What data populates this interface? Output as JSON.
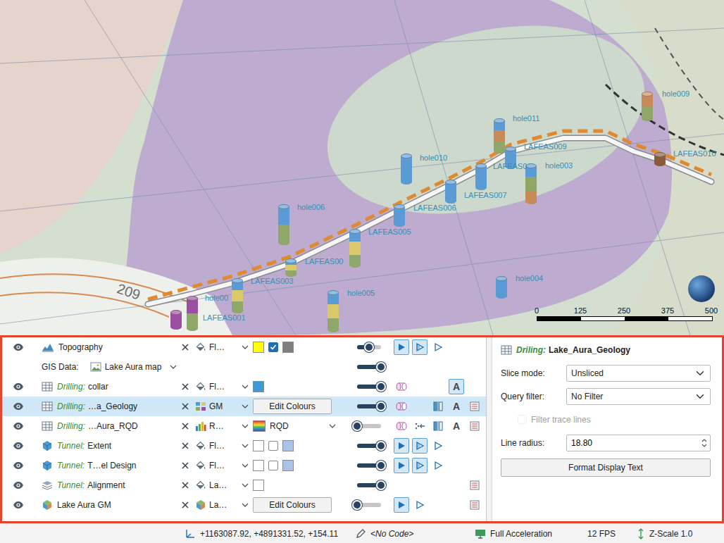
{
  "viewer": {
    "holes": [
      {
        "label": "hole009",
        "segments": [
          "#c98a5a",
          "#8fa86a"
        ]
      },
      {
        "label": "hole011",
        "segments": [
          "#5b9bd5",
          "#c98a5a",
          "#8fa86a"
        ]
      },
      {
        "label": "LAFEAS009",
        "segments": [
          "#5b9bd5"
        ]
      },
      {
        "label": "LAFEAS010",
        "segments": [
          "#8b5a3a"
        ]
      },
      {
        "label": "hole003",
        "segments": [
          "#5b9bd5",
          "#8fa86a",
          "#c98a5a"
        ]
      },
      {
        "label": "LAFEAS0",
        "segments": [
          "#5b9bd5"
        ]
      },
      {
        "label": "LAFEAS007",
        "segments": [
          "#5b9bd5"
        ]
      },
      {
        "label": "hole010",
        "segments": [
          "#5b9bd5"
        ]
      },
      {
        "label": "LAFEAS006",
        "segments": [
          "#5b9bd5"
        ]
      },
      {
        "label": "hole006",
        "segments": [
          "#5b9bd5",
          "#8fa86a"
        ]
      },
      {
        "label": "LAFEAS005",
        "segments": [
          "#5b9bd5",
          "#d9c96a",
          "#8fa86a"
        ]
      },
      {
        "label": "LAFEAS00",
        "segments": [
          "#5b9bd5",
          "#d9c96a",
          "#8fa86a"
        ]
      },
      {
        "label": "LAFEAS003",
        "segments": [
          "#5b9bd5",
          "#d9c96a",
          "#8fa86a"
        ]
      },
      {
        "label": "hole005",
        "segments": [
          "#5b9bd5",
          "#d9c96a",
          "#8fa86a"
        ]
      },
      {
        "label": "hole004",
        "segments": [
          "#5b9bd5"
        ]
      },
      {
        "label": "hole00",
        "segments": [
          "#9b4fa0",
          "#8fa86a"
        ]
      },
      {
        "label": "LAFEAS001",
        "segments": [
          "#9b4fa0"
        ]
      }
    ],
    "contour_label": "209",
    "scale": [
      "0",
      "125",
      "250",
      "375",
      "500"
    ]
  },
  "shape_list": {
    "rows": [
      {
        "kind": "topography",
        "name": "Topography",
        "visible": true,
        "selected": false,
        "style": {
          "kind": "fill",
          "text": "Fl…"
        },
        "colors": {
          "kind": "swatches",
          "items": [
            {
              "kind": "swatch",
              "color": "#ffff00"
            },
            {
              "kind": "checkbox",
              "checked": true
            },
            {
              "kind": "swatch",
              "color": "#7f7f7f"
            }
          ]
        },
        "slider": {
          "level": 0.5
        },
        "tools": [
          {
            "kind": "play",
            "pressed": true
          },
          {
            "kind": "slice",
            "pressed": true
          },
          {
            "kind": "triangle",
            "pressed": false
          },
          {
            "kind": "none"
          },
          {
            "kind": "none"
          }
        ]
      },
      {
        "kind": "gis",
        "name": "GIS Data:",
        "map": "Lake Aura map",
        "selected": false,
        "slider": {
          "level": 1
        },
        "tools": [
          {
            "kind": "none"
          },
          {
            "kind": "none"
          },
          {
            "kind": "none"
          },
          {
            "kind": "none"
          },
          {
            "kind": "none"
          }
        ]
      },
      {
        "kind": "drillhole",
        "prefix": "Drilling:",
        "name": "collar",
        "visible": true,
        "selected": false,
        "style": {
          "kind": "fill",
          "text": "Fl…"
        },
        "colors": {
          "kind": "swatches",
          "items": [
            {
              "kind": "swatch",
              "color": "#3d9ad8"
            }
          ]
        },
        "slider": {
          "level": 1
        },
        "tools": [
          {
            "kind": "cylinder",
            "pressed": false
          },
          {
            "kind": "none"
          },
          {
            "kind": "none"
          },
          {
            "kind": "label",
            "text": "A",
            "pressed": true
          },
          {
            "kind": "none"
          }
        ]
      },
      {
        "kind": "drillhole",
        "prefix": "Drilling:",
        "name": "…a_Geology",
        "visible": true,
        "selected": true,
        "style": {
          "kind": "category",
          "text": "GM"
        },
        "colors": {
          "kind": "button",
          "text": "Edit Colours"
        },
        "slider": {
          "level": 1
        },
        "tools": [
          {
            "kind": "cylinder",
            "pressed": false
          },
          {
            "kind": "none"
          },
          {
            "kind": "bars",
            "pressed": false
          },
          {
            "kind": "label",
            "text": "A",
            "pressed": false
          },
          {
            "kind": "table",
            "pressed": false
          }
        ]
      },
      {
        "kind": "drillhole",
        "prefix": "Drilling:",
        "name": "…Aura_RQD",
        "visible": true,
        "selected": false,
        "style": {
          "kind": "range",
          "text": "R…"
        },
        "colors": {
          "kind": "gradient",
          "text": "RQD"
        },
        "slider": {
          "level": 0
        },
        "tools": [
          {
            "kind": "cylinder",
            "pressed": false
          },
          {
            "kind": "arrows",
            "pressed": false
          },
          {
            "kind": "bars",
            "pressed": false
          },
          {
            "kind": "label",
            "text": "A",
            "pressed": false
          },
          {
            "kind": "table",
            "pressed": false
          }
        ]
      },
      {
        "kind": "mesh",
        "prefix": "Tunnel:",
        "name": "Extent",
        "visible": true,
        "selected": false,
        "style": {
          "kind": "fill",
          "text": "Fl…"
        },
        "colors": {
          "kind": "swatches",
          "items": [
            {
              "kind": "swatch",
              "color": "#ffffff"
            },
            {
              "kind": "checkbox",
              "checked": false
            },
            {
              "kind": "swatch",
              "color": "#a9c4e8"
            }
          ]
        },
        "slider": {
          "level": 1
        },
        "tools": [
          {
            "kind": "play",
            "pressed": true
          },
          {
            "kind": "slice",
            "pressed": true
          },
          {
            "kind": "triangle",
            "pressed": false
          },
          {
            "kind": "none"
          },
          {
            "kind": "none"
          }
        ]
      },
      {
        "kind": "mesh",
        "prefix": "Tunnel:",
        "name": "T…el Design",
        "visible": true,
        "selected": false,
        "style": {
          "kind": "fill",
          "text": "Fl…"
        },
        "colors": {
          "kind": "swatches",
          "items": [
            {
              "kind": "swatch",
              "color": "#ffffff"
            },
            {
              "kind": "checkbox",
              "checked": false
            },
            {
              "kind": "swatch",
              "color": "#a9c4e8"
            }
          ]
        },
        "slider": {
          "level": 1
        },
        "tools": [
          {
            "kind": "play",
            "pressed": true
          },
          {
            "kind": "slice",
            "pressed": true
          },
          {
            "kind": "triangle",
            "pressed": false
          },
          {
            "kind": "none"
          },
          {
            "kind": "none"
          }
        ]
      },
      {
        "kind": "lines",
        "prefix": "Tunnel:",
        "name": "Alignment",
        "visible": true,
        "selected": false,
        "style": {
          "kind": "fill",
          "text": "La…"
        },
        "colors": {
          "kind": "swatches",
          "items": [
            {
              "kind": "swatch",
              "color": "#ffffff"
            }
          ]
        },
        "slider": {
          "level": 1
        },
        "tools": [
          {
            "kind": "none"
          },
          {
            "kind": "none"
          },
          {
            "kind": "none"
          },
          {
            "kind": "none"
          },
          {
            "kind": "table",
            "pressed": false
          }
        ]
      },
      {
        "kind": "model",
        "name": "Lake Aura GM",
        "visible": true,
        "selected": false,
        "style": {
          "kind": "model",
          "text": "La…"
        },
        "colors": {
          "kind": "button",
          "text": "Edit Colours"
        },
        "slider": {
          "level": 0
        },
        "tools": [
          {
            "kind": "play",
            "pressed": true
          },
          {
            "kind": "triangle",
            "pressed": false
          },
          {
            "kind": "none"
          },
          {
            "kind": "none"
          },
          {
            "kind": "table",
            "pressed": false
          }
        ]
      }
    ]
  },
  "properties": {
    "title_prefix": "Driling:",
    "title": "Lake_Aura_Geology",
    "fields": [
      {
        "kind": "select",
        "label": "Slice mode:",
        "value": "Unsliced"
      },
      {
        "kind": "select",
        "label": "Query filter:",
        "value": "No Filter"
      },
      {
        "kind": "checkbox",
        "label": "Filter trace lines",
        "checked": false,
        "disabled": true
      },
      {
        "kind": "spin",
        "label": "Line radius:",
        "value": "18.80"
      }
    ],
    "button": "Format Display Text"
  },
  "status_bar": {
    "coordinates": "+1163087.92, +4891331.52, +154.11",
    "code": "<No Code>",
    "acceleration": "Full Acceleration",
    "fps": "12 FPS",
    "z_scale": "Z-Scale 1.0"
  }
}
